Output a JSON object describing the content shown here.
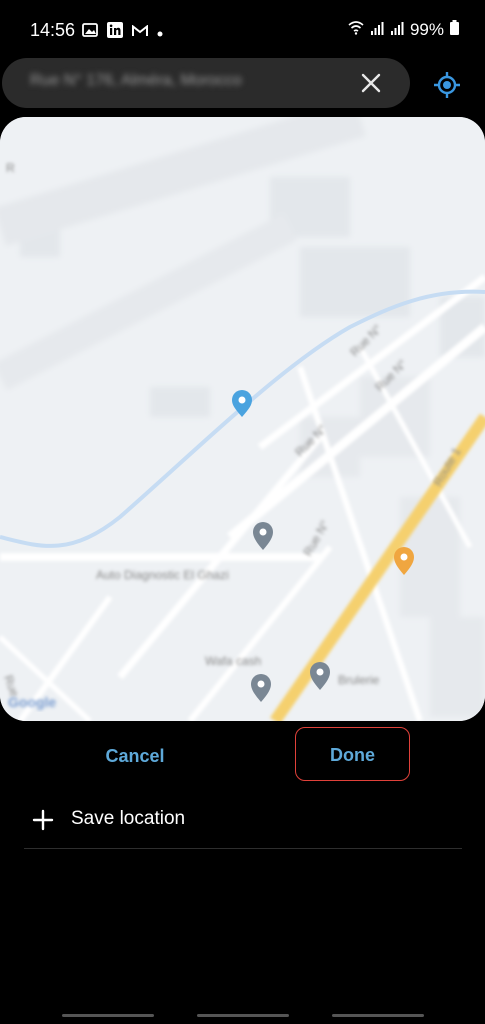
{
  "status_bar": {
    "time": "14:56",
    "battery": "99%",
    "notification_icons": [
      "gallery-icon",
      "linkedin-icon",
      "gmail-icon",
      "dot-icon"
    ],
    "system_icons": [
      "wifi-icon",
      "signal-icon",
      "signal-icon",
      "battery-icon"
    ]
  },
  "search": {
    "value": "Rue N° 176, Alméra, Morocco"
  },
  "map": {
    "road_label_1": "Route 1",
    "poi_1": "Auto Diagnostic El Ghazi",
    "poi_2": "Wafa cash",
    "poi_3": "Brulerie",
    "street_labels": [
      "Rue N°",
      "Rue N°",
      "Rue N°",
      "Rue N°"
    ],
    "edge_label_top": "R",
    "edge_label_bottom": "Rue",
    "logo": "Google",
    "colors": {
      "river": "#c6dcf3",
      "highway": "#f5d06e",
      "poi_orange": "#f0a640",
      "poi_gray": "#7a8794",
      "pin_blue": "#4aa3df"
    }
  },
  "actions": {
    "cancel": "Cancel",
    "done": "Done",
    "save_location": "Save location"
  }
}
